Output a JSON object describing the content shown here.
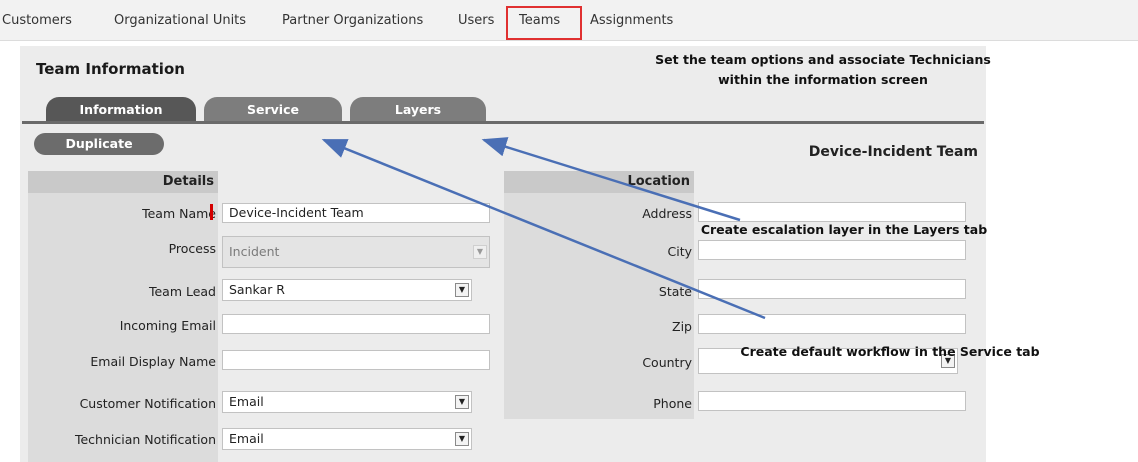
{
  "nav": {
    "items": [
      "Customers",
      "Organizational Units",
      "Partner Organizations",
      "Users",
      "Teams",
      "Assignments"
    ],
    "active": "Teams"
  },
  "panel": {
    "title": "Team Information"
  },
  "annotations": {
    "top": "Set the team options and associate Technicians within the information screen",
    "layers": "Create escalation layer in the Layers tab",
    "service": "Create default workflow in the Service tab"
  },
  "tabs": [
    {
      "label": "Information",
      "active": true
    },
    {
      "label": "Service",
      "active": false
    },
    {
      "label": "Layers",
      "active": false
    }
  ],
  "toolbar": {
    "duplicate_label": "Duplicate"
  },
  "record": {
    "title": "Device-Incident Team"
  },
  "details": {
    "header": "Details",
    "fields": {
      "team_name": {
        "label": "Team Name",
        "value": "Device-Incident Team"
      },
      "process": {
        "label": "Process",
        "value": "Incident"
      },
      "team_lead": {
        "label": "Team Lead",
        "value": "Sankar R"
      },
      "incoming_email": {
        "label": "Incoming Email",
        "value": ""
      },
      "email_display_name": {
        "label": "Email Display Name",
        "value": ""
      },
      "customer_notification": {
        "label": "Customer Notification",
        "value": "Email"
      },
      "technician_notification": {
        "label": "Technician Notification",
        "value": "Email"
      }
    }
  },
  "location": {
    "header": "Location",
    "fields": {
      "address": {
        "label": "Address",
        "value": ""
      },
      "city": {
        "label": "City",
        "value": ""
      },
      "state": {
        "label": "State",
        "value": ""
      },
      "zip": {
        "label": "Zip",
        "value": ""
      },
      "country": {
        "label": "Country",
        "value": ""
      },
      "phone": {
        "label": "Phone",
        "value": ""
      }
    }
  },
  "colors": {
    "required_marker": "#d40000",
    "nav_highlight": "#e03030",
    "arrow": "#4a6fb5",
    "tab_active": "#575757",
    "tab_inactive": "#7d7d7d"
  }
}
